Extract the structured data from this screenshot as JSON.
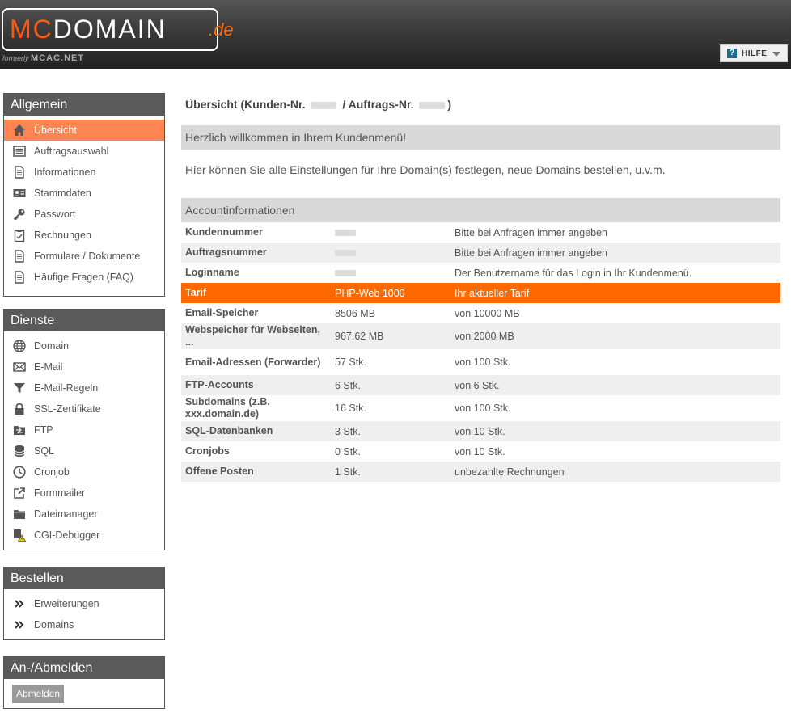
{
  "header": {
    "logo_mc": "Mc",
    "logo_domain": "Domain",
    "logo_tld": ".de",
    "formerly_prefix": "formerly",
    "formerly_name": "McAc.NET",
    "help_label": "HILFE"
  },
  "sidebar": {
    "allgemein": {
      "title": "Allgemein",
      "items": [
        {
          "label": "Übersicht",
          "icon": "home-icon"
        },
        {
          "label": "Auftragsauswahl",
          "icon": "list-icon"
        },
        {
          "label": "Informationen",
          "icon": "document-icon"
        },
        {
          "label": "Stammdaten",
          "icon": "id-card-icon"
        },
        {
          "label": "Passwort",
          "icon": "key-icon"
        },
        {
          "label": "Rechnungen",
          "icon": "clipboard-icon"
        },
        {
          "label": "Formulare / Dokumente",
          "icon": "document-icon"
        },
        {
          "label": "Häufige Fragen (FAQ)",
          "icon": "document-icon"
        }
      ]
    },
    "dienste": {
      "title": "Dienste",
      "items": [
        {
          "label": "Domain",
          "icon": "globe-icon"
        },
        {
          "label": "E-Mail",
          "icon": "envelope-icon"
        },
        {
          "label": "E-Mail-Regeln",
          "icon": "funnel-icon"
        },
        {
          "label": "SSL-Zertifikate",
          "icon": "lock-icon"
        },
        {
          "label": "FTP",
          "icon": "folder-transfer-icon"
        },
        {
          "label": "SQL",
          "icon": "database-icon"
        },
        {
          "label": "Cronjob",
          "icon": "clock-icon"
        },
        {
          "label": "Formmailer",
          "icon": "external-link-icon"
        },
        {
          "label": "Dateimanager",
          "icon": "folder-icon"
        },
        {
          "label": "CGI-Debugger",
          "icon": "warning-file-icon"
        }
      ]
    },
    "bestellen": {
      "title": "Bestellen",
      "items": [
        {
          "label": "Erweiterungen",
          "icon": "double-chevron-icon"
        },
        {
          "label": "Domains",
          "icon": "double-chevron-icon"
        }
      ]
    },
    "abmelden": {
      "title": "An-/Abmelden",
      "button_label": "Abmelden"
    }
  },
  "main": {
    "title_prefix": "Übersicht (Kunden-Nr.",
    "title_mid": "/ Auftrags-Nr.",
    "title_suffix": ")",
    "welcome": "Herzlich willkommen in Ihrem Kundenmenü!",
    "intro": "Hier können Sie alle Einstellungen für Ihre Domain(s) festlegen, neue Domains bestellen, u.v.m.",
    "account_header": "Accountinformationen",
    "rows": [
      {
        "label": "Kundennummer",
        "value": "",
        "note": "Bitte bei Anfragen immer angeben"
      },
      {
        "label": "Auftragsnummer",
        "value": "",
        "note": "Bitte bei Anfragen immer angeben"
      },
      {
        "label": "Loginname",
        "value": "",
        "note": "Der Benutzername für das Login in Ihr Kundenmenü."
      },
      {
        "label": "Tarif",
        "value": "PHP-Web 1000",
        "note": "Ihr aktueller Tarif"
      },
      {
        "label": "Email-Speicher",
        "value": "8506 MB",
        "note": "von 10000 MB"
      },
      {
        "label": "Webspeicher für Webseiten, ...",
        "value": "967.62 MB",
        "note": "von 2000 MB"
      },
      {
        "label": "Email-Adressen (Forwarder)",
        "value": "57 Stk.",
        "note": "von 100 Stk."
      },
      {
        "label": "FTP-Accounts",
        "value": "6 Stk.",
        "note": "von 6 Stk."
      },
      {
        "label": "Subdomains (z.B. xxx.domain.de)",
        "value": "16 Stk.",
        "note": "von 100 Stk."
      },
      {
        "label": "SQL-Datenbanken",
        "value": "3 Stk.",
        "note": "von 10 Stk."
      },
      {
        "label": "Cronjobs",
        "value": "0 Stk.",
        "note": "von 10 Stk."
      },
      {
        "label": "Offene Posten",
        "value": "1 Stk.",
        "note": "unbezahlte Rechnungen"
      }
    ]
  },
  "colors": {
    "accent_orange": "#ff6a00",
    "active_nav": "#ff8552",
    "panel_title_bg": "#5a5a5a",
    "bar_bg": "#d8d8d8"
  }
}
